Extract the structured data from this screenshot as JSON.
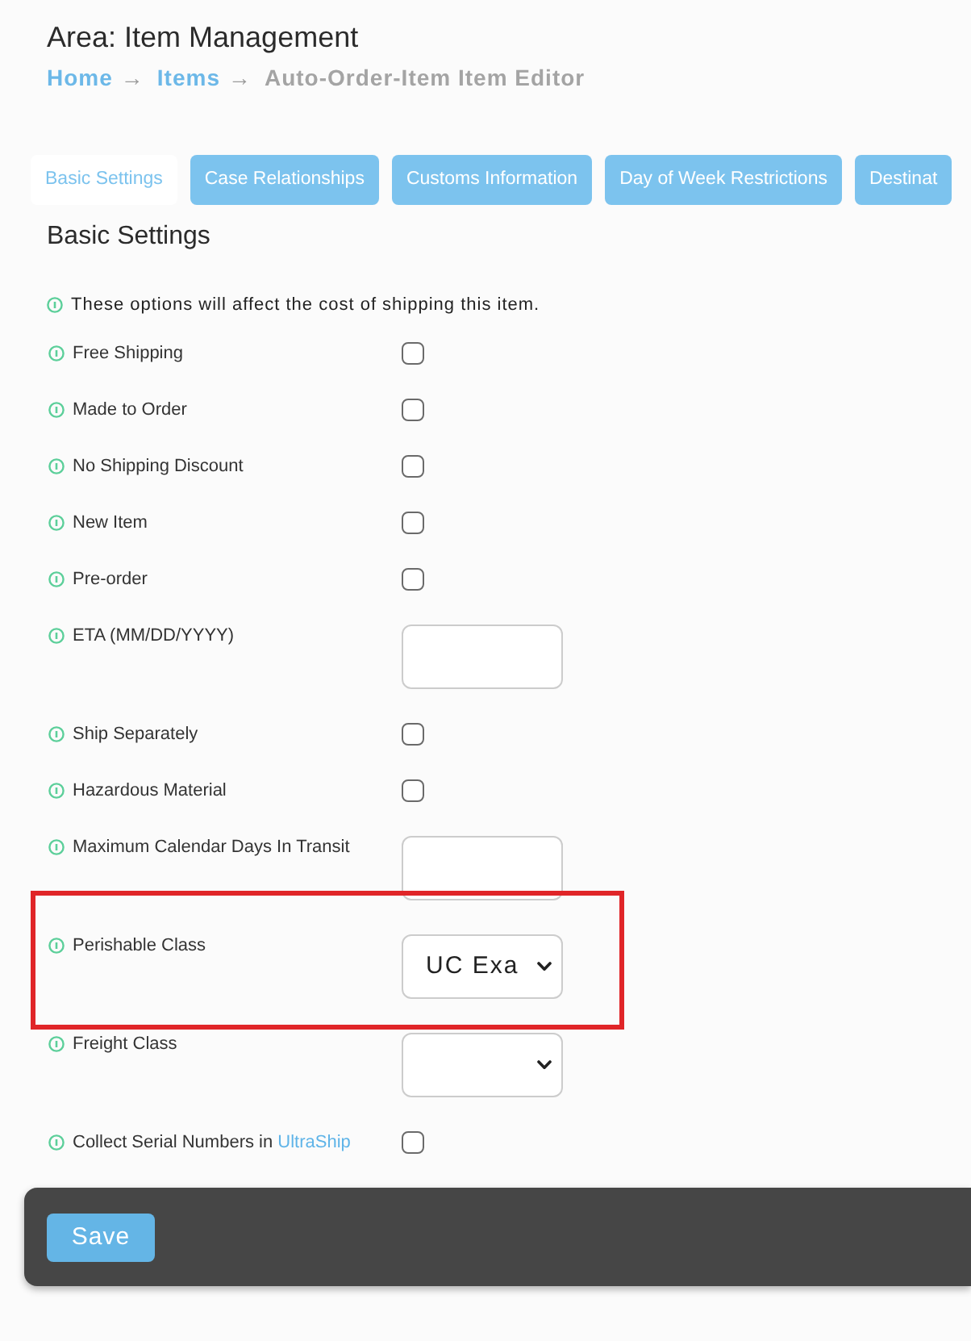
{
  "header": {
    "title": "Area: Item Management",
    "breadcrumb": [
      {
        "label": "Home",
        "kind": "link",
        "separator": "→"
      },
      {
        "label": "Items",
        "kind": "link",
        "separator": "→"
      },
      {
        "label": "Auto-Order-Item Item Editor",
        "kind": "current"
      }
    ]
  },
  "tabs": [
    {
      "label": "Basic Settings",
      "selected": true
    },
    {
      "label": "Case Relationships",
      "selected": false
    },
    {
      "label": "Customs Information",
      "selected": false
    },
    {
      "label": "Day of Week Restrictions",
      "selected": false
    },
    {
      "label": "Destinat",
      "selected": false
    }
  ],
  "section": {
    "title": "Basic Settings",
    "note": "These options will affect the cost of shipping this item.",
    "fields": [
      {
        "label": "Free Shipping",
        "kind": "checkbox",
        "checked": false,
        "highlighted": false
      },
      {
        "label": "Made to Order",
        "kind": "checkbox",
        "checked": false,
        "highlighted": false
      },
      {
        "label": "No Shipping Discount",
        "kind": "checkbox",
        "checked": false,
        "highlighted": false
      },
      {
        "label": "New Item",
        "kind": "checkbox",
        "checked": false,
        "highlighted": false
      },
      {
        "label": "Pre-order",
        "kind": "checkbox",
        "checked": false,
        "highlighted": false
      },
      {
        "label": "ETA (MM/DD/YYYY)",
        "kind": "text",
        "highlighted": false
      },
      {
        "label": "Ship Separately",
        "kind": "checkbox",
        "checked": false,
        "highlighted": false
      },
      {
        "label": "Hazardous Material",
        "kind": "checkbox",
        "checked": false,
        "highlighted": false
      },
      {
        "label": "Maximum Calendar Days In Transit",
        "kind": "text",
        "highlighted": false
      },
      {
        "label": "Perishable Class",
        "kind": "select",
        "value": "UC Exa",
        "highlighted": true
      },
      {
        "label": "Freight Class",
        "kind": "select",
        "highlighted": false
      },
      {
        "label": "Collect Serial Numbers in",
        "link": "UltraShip",
        "kind": "checkbox",
        "checked": false,
        "highlighted": false
      }
    ]
  },
  "save_button": "Save"
}
